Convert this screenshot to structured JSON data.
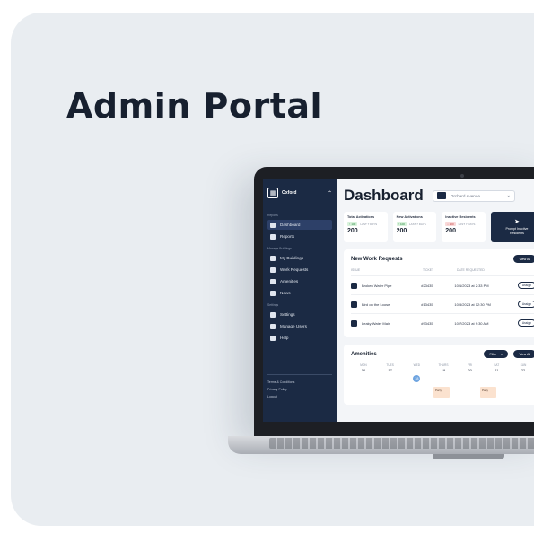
{
  "headline": "Admin Portal",
  "sidebar": {
    "brand": "Oxford",
    "sections": {
      "reports": "Reports",
      "manage": "Manage Buildings",
      "settings": "Settings"
    },
    "items": [
      {
        "label": "Dashboard",
        "icon": "grid-icon",
        "active": true
      },
      {
        "label": "Reports",
        "icon": "report-icon"
      },
      {
        "label": "My Buildings",
        "icon": "building-icon"
      },
      {
        "label": "Work Requests",
        "icon": "tools-icon"
      },
      {
        "label": "Amenities",
        "icon": "amenity-icon"
      },
      {
        "label": "News",
        "icon": "news-icon"
      },
      {
        "label": "Settings",
        "icon": "user-icon"
      },
      {
        "label": "Manage Users",
        "icon": "users-icon"
      },
      {
        "label": "Help",
        "icon": "help-icon"
      }
    ],
    "footer": [
      "Terms & Conditions",
      "Privacy Policy",
      "Logout"
    ]
  },
  "main": {
    "title": "Dashboard",
    "building": "Orchard Avenue",
    "stats": [
      {
        "label": "Total Activations",
        "badge": "↑ 100",
        "badge_color": "green",
        "sub": "LAST 7 DAYS",
        "value": "200"
      },
      {
        "label": "New Activations",
        "badge": "↑ 100",
        "badge_color": "green",
        "sub": "LAST 7 DAYS",
        "value": "200"
      },
      {
        "label": "Inactive Residents",
        "badge": "↓ 100",
        "badge_color": "red",
        "sub": "LAST 7 DAYS",
        "value": "200"
      }
    ],
    "prompt": "Prompt Inactive Residents",
    "work_requests": {
      "title": "New Work Requests",
      "view_all": "View All",
      "columns": [
        "ISSUE",
        "TICKET",
        "DATE REQUESTED"
      ],
      "rows": [
        {
          "issue": "Broken Water Pipe",
          "ticket": "#23435",
          "date": "10/1/2023 at 2:33 PM",
          "action": "Assign"
        },
        {
          "issue": "Bird on the Loose",
          "ticket": "#13435",
          "date": "10/5/2023 at 12:30 PM",
          "action": "Assign"
        },
        {
          "issue": "Leaky Water Main",
          "ticket": "#93435",
          "date": "10/7/2023 at 9:30 AM",
          "action": "Assign"
        }
      ]
    },
    "amenities": {
      "title": "Amenities",
      "filter": "Filter",
      "view_all": "View All",
      "days": [
        {
          "name": "MON",
          "num": "16"
        },
        {
          "name": "TUES",
          "num": "17"
        },
        {
          "name": "WED",
          "num": "18",
          "today": true
        },
        {
          "name": "THURS",
          "num": "19"
        },
        {
          "name": "FRI",
          "num": "20"
        },
        {
          "name": "SAT",
          "num": "21"
        },
        {
          "name": "SUN",
          "num": "22"
        }
      ],
      "events": [
        {
          "label": "Party",
          "day_index": 3
        },
        {
          "label": "Party",
          "day_index": 5
        }
      ]
    }
  },
  "colors": {
    "navy": "#1b2a44",
    "card_bg": "#e9edf1",
    "accent_today": "#6ea4e0",
    "event": "#fbe2cf"
  }
}
